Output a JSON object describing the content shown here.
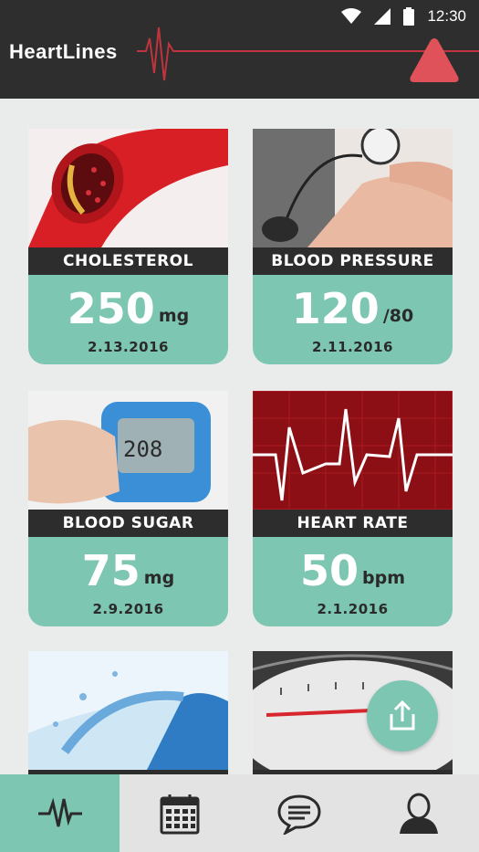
{
  "status_bar": {
    "time": "12:30",
    "icons": [
      "wifi-icon",
      "signal-icon",
      "battery-icon"
    ]
  },
  "header": {
    "brand": "HeartLines",
    "alert_icon": "warning-triangle-icon"
  },
  "colors": {
    "header_bg": "#2e2e2e",
    "accent_teal": "#7dc6b2",
    "alert_red": "#e0525a",
    "label_bar": "#2d2d2d"
  },
  "cards": [
    {
      "label": "CHOLESTEROL",
      "value": "250",
      "unit": "mg",
      "date": "2.13.2016",
      "image": "artery-photo"
    },
    {
      "label": "BLOOD PRESSURE",
      "value": "120",
      "unit": "/80",
      "date": "2.11.2016",
      "image": "blood-pressure-cuff-photo"
    },
    {
      "label": "BLOOD SUGAR",
      "value": "75",
      "unit": "mg",
      "date": "2.9.2016",
      "image": "glucose-meter-photo"
    },
    {
      "label": "HEART RATE",
      "value": "50",
      "unit": "bpm",
      "date": "2.1.2016",
      "image": "ekg-photo"
    },
    {
      "label": "",
      "value": "",
      "unit": "",
      "date": "",
      "image": "water-bottle-photo"
    },
    {
      "label": "",
      "value": "",
      "unit": "",
      "date": "",
      "image": "scale-photo"
    }
  ],
  "fab": {
    "icon": "share-icon"
  },
  "bottom_nav": [
    {
      "icon": "heartbeat-icon",
      "active": true
    },
    {
      "icon": "calendar-icon",
      "active": false
    },
    {
      "icon": "chat-icon",
      "active": false
    },
    {
      "icon": "profile-icon",
      "active": false
    }
  ]
}
